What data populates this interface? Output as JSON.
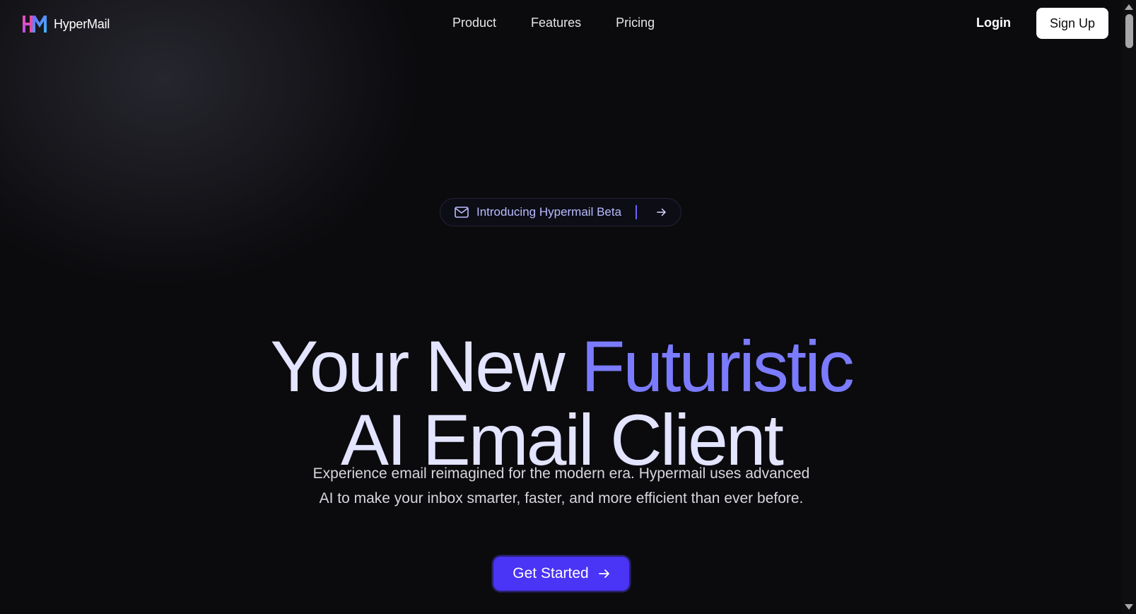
{
  "nav": {
    "brand": "HyperMail",
    "links": [
      "Product",
      "Features",
      "Pricing"
    ],
    "login": "Login",
    "signup": "Sign Up"
  },
  "badge": {
    "text": "Introducing Hypermail Beta",
    "icons": [
      "mail-icon",
      "arrow-right-icon"
    ]
  },
  "hero": {
    "title_part1": "Your New ",
    "title_accent": "Futuristic",
    "title_line2": "AI Email Client",
    "subtitle_line1": "Experience email reimagined for the modern era. Hypermail uses advanced",
    "subtitle_line2": "AI to make your inbox smarter, faster, and more efficient than ever before.",
    "cta": "Get Started"
  },
  "colors": {
    "background": "#0b0b0e",
    "accent": "#7b7bff",
    "cta": "#4a34f5",
    "title": "#e3e4ff"
  }
}
